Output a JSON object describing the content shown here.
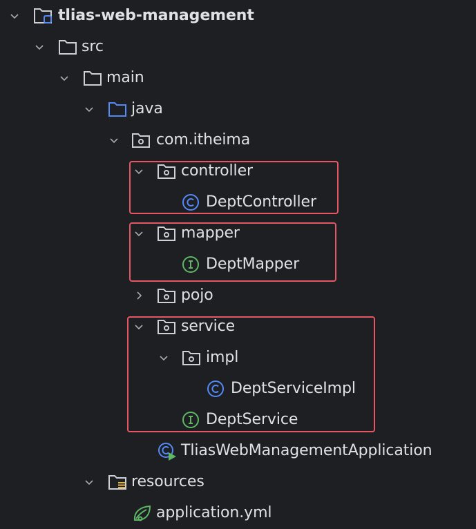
{
  "tree": {
    "root": {
      "label": "tlias-web-management",
      "expanded": true
    },
    "src": {
      "label": "src",
      "expanded": true
    },
    "main": {
      "label": "main",
      "expanded": true
    },
    "java": {
      "label": "java",
      "expanded": true
    },
    "package": {
      "label": "com.itheima",
      "expanded": true
    },
    "controller": {
      "label": "controller",
      "expanded": true
    },
    "dept_controller": {
      "label": "DeptController",
      "kind": "class"
    },
    "mapper": {
      "label": "mapper",
      "expanded": true
    },
    "dept_mapper": {
      "label": "DeptMapper",
      "kind": "interface"
    },
    "pojo": {
      "label": "pojo",
      "expanded": false
    },
    "service": {
      "label": "service",
      "expanded": true
    },
    "impl": {
      "label": "impl",
      "expanded": true
    },
    "dept_service_impl": {
      "label": "DeptServiceImpl",
      "kind": "class"
    },
    "dept_service": {
      "label": "DeptService",
      "kind": "interface"
    },
    "app": {
      "label": "TliasWebManagementApplication",
      "kind": "spring-boot-application"
    },
    "resources": {
      "label": "resources",
      "expanded": true
    },
    "app_yml": {
      "label": "application.yml",
      "kind": "spring-config"
    }
  },
  "colors": {
    "background": "#1e1f22",
    "text": "#dfe1e5",
    "highlight_box": "#e55765",
    "class_icon": "#548af7",
    "interface_icon": "#5fb865",
    "source_folder": "#548af7",
    "spring": "#5fb865"
  },
  "icons": {
    "module": "module-folder-icon",
    "folder": "folder-icon",
    "source_root": "source-folder-icon",
    "package": "package-icon",
    "class": "class-icon",
    "interface": "interface-icon",
    "resources": "resources-folder-icon",
    "spring_app": "spring-boot-icon",
    "spring_config": "spring-config-icon"
  }
}
